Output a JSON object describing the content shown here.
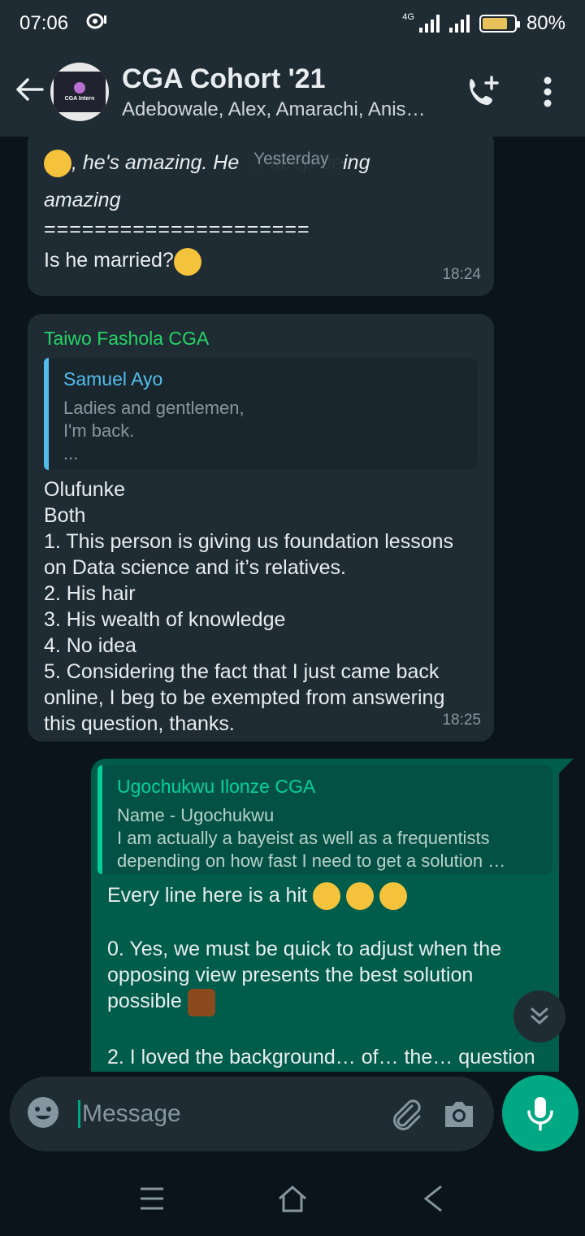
{
  "status_bar": {
    "time": "07:06",
    "network": "4G",
    "battery": "80%",
    "battery_level": 0.8
  },
  "header": {
    "title": "CGA Cohort '21",
    "subtitle": "Adebowale, Alex, Amarachi, Anis…",
    "avatar_text": "CGA Intern"
  },
  "chat": {
    "date_chip": "Yesterday",
    "messages": [
      {
        "type": "incoming",
        "text_line1": ", he's amazing. He … keep being",
        "text_line2": "amazing",
        "divider": "=====================",
        "text_line3": "Is he married?",
        "time": "18:24"
      },
      {
        "type": "incoming",
        "sender": "Taiwo Fashola CGA",
        "quote_name": "Samuel Ayo",
        "quote_text": "Ladies and gentlemen,\nI'm back.\n...",
        "body": "Olufunke\nBoth\n1. This person is giving us foundation lessons on Data science and it’s relatives.\n2. His hair\n3. His wealth of knowledge\n4. No idea\n5. Considering the fact that I just came back online, I beg to be exempted from answering this question, thanks.",
        "time": "18:25"
      },
      {
        "type": "outgoing",
        "quote_name": "Ugochukwu Ilonze CGA",
        "quote_text": "Name - Ugochukwu\nI am actually a bayeist as well as a frequentists\ndepending on how fast I need to get a solution …",
        "body_line1": "Every line here is a hit",
        "body_line2": "0. Yes, we must be quick to adjust when the opposing view presents the best solution possible",
        "body_line3": "2. I loved the background… of… the… question"
      }
    ]
  },
  "composer": {
    "placeholder": "Message"
  },
  "icons": {
    "back": "arrow-left-icon",
    "call": "add-call-icon",
    "menu": "more-vert-icon",
    "emoji": "emoji-icon",
    "attach": "paperclip-icon",
    "camera": "camera-icon",
    "mic": "mic-icon",
    "scroll_down": "double-chevron-down-icon"
  },
  "colors": {
    "header_bg": "#1f2c34",
    "chat_bg": "#0b141a",
    "incoming_bubble": "#1f2c34",
    "outgoing_bubble": "#005c4b",
    "accent": "#00a884"
  }
}
